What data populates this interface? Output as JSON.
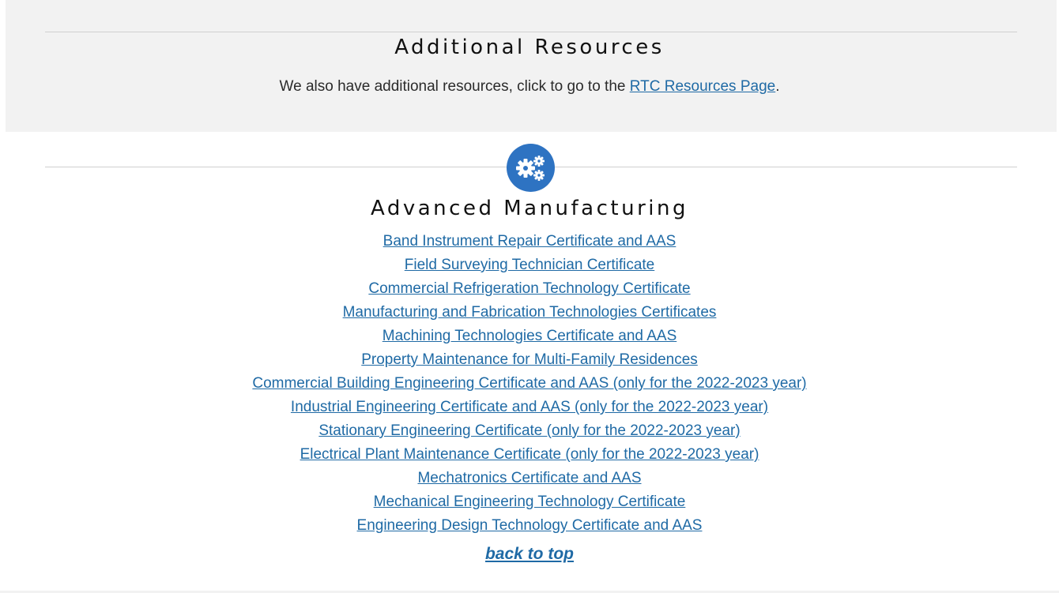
{
  "resources": {
    "title": "Additional Resources",
    "intro_text": "We also have additional resources, click to go to the ",
    "link_label": "RTC Resources Page",
    "trailing": "."
  },
  "section": {
    "icon": "gears-icon",
    "accent": "#2e73c2",
    "title": "Advanced Manufacturing",
    "links": [
      "Band Instrument Repair Certificate and AAS",
      "Field Surveying Technician Certificate",
      "Commercial Refrigeration Technology Certificate",
      "Manufacturing and Fabrication Technologies Certificates",
      "Machining Technologies Certificate and AAS",
      "Property Maintenance for Multi-Family Residences",
      "Commercial Building Engineering Certificate and AAS (only for the 2022-2023 year)",
      "Industrial Engineering Certificate and AAS (only for the 2022-2023 year)",
      "Stationary Engineering Certificate (only for the 2022-2023 year)",
      "Electrical Plant Maintenance Certificate (only for the 2022-2023 year)",
      "Mechatronics Certificate and AAS",
      "Mechanical Engineering Technology Certificate",
      "Engineering Design Technology Certificate and AAS"
    ],
    "back_to_top": "back to top"
  },
  "colors": {
    "link": "#1f6aa5",
    "panel_background": "#f2f2f2"
  }
}
